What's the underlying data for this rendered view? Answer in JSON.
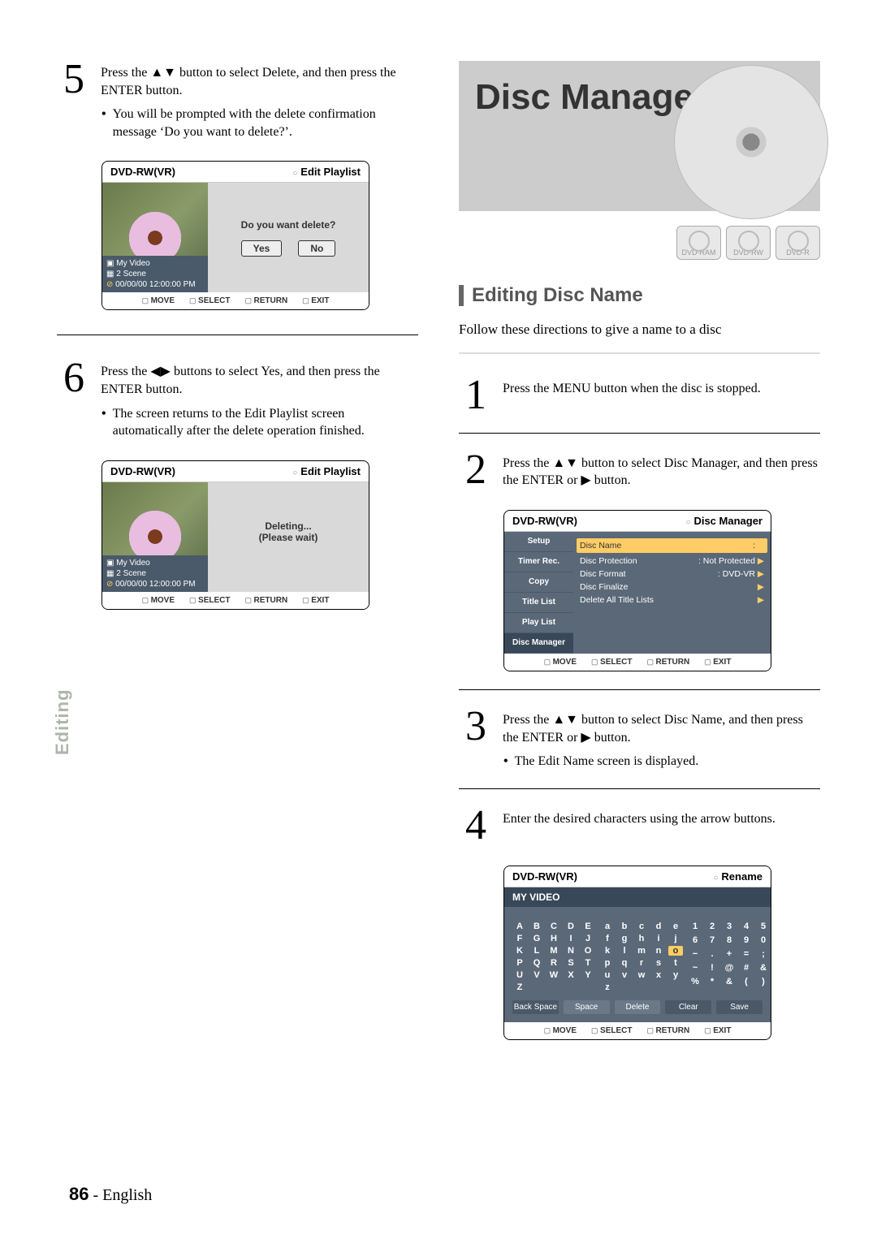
{
  "side_tab": "Editing",
  "footer_page": "86",
  "footer_lang": "English",
  "left": {
    "step5": {
      "num": "5",
      "text_a": "Press the ",
      "text_arrows": "▲▼",
      "text_b": " button to select Delete, and then press the ENTER button.",
      "bullet": "You will be prompted with the delete confirmation message ‘Do you want to delete?’."
    },
    "osd5": {
      "head_left": "DVD-RW(VR)",
      "head_right": "Edit Playlist",
      "thumb_title": "My Video",
      "thumb_scene": "2 Scene",
      "thumb_time": "00/00/00 12:00:00  PM",
      "msg": "Do you want delete?",
      "yes": "Yes",
      "no": "No",
      "foot": {
        "move": "MOVE",
        "select": "SELECT",
        "return": "RETURN",
        "exit": "EXIT"
      }
    },
    "step6": {
      "num": "6",
      "text_a": "Press the ",
      "text_arrows": "◀▶",
      "text_b": " buttons to select Yes, and then press the ENTER button.",
      "bullet": "The screen returns to the Edit Playlist screen automatically after the delete operation finished."
    },
    "osd6": {
      "head_left": "DVD-RW(VR)",
      "head_right": "Edit Playlist",
      "msg1": "Deleting...",
      "msg2": "(Please wait)",
      "thumb_title": "My Video",
      "thumb_scene": "2 Scene",
      "thumb_time": "00/00/00 12:00:00  PM",
      "foot": {
        "move": "MOVE",
        "select": "SELECT",
        "return": "RETURN",
        "exit": "EXIT"
      }
    }
  },
  "right": {
    "hero_title": "Disc Manager",
    "badges": [
      "DVD-RAM",
      "DVD-RW",
      "DVD-R"
    ],
    "section_title": "Editing Disc Name",
    "intro": "Follow these directions to give a name to a disc",
    "step1": {
      "num": "1",
      "text": "Press the MENU button when the disc is stopped."
    },
    "step2": {
      "num": "2",
      "text_a": "Press the ",
      "text_arrows": "▲▼",
      "text_b": " button to select Disc Manager, and then press the ENTER or ",
      "text_arrow2": "▶",
      "text_c": " button."
    },
    "osd2": {
      "head_left": "DVD-RW(VR)",
      "head_right": "Disc Manager",
      "side": [
        "Setup",
        "Timer Rec.",
        "Copy",
        "Title List",
        "Play List",
        "Disc Manager"
      ],
      "rows": [
        {
          "l": "Disc Name",
          "r": ":"
        },
        {
          "l": "Disc Protection",
          "r": ": Not Protected"
        },
        {
          "l": "Disc Format",
          "r": ": DVD-VR"
        },
        {
          "l": "Disc Finalize",
          "r": ""
        },
        {
          "l": "Delete All Title Lists",
          "r": ""
        }
      ],
      "foot": {
        "move": "MOVE",
        "select": "SELECT",
        "return": "RETURN",
        "exit": "EXIT"
      }
    },
    "step3": {
      "num": "3",
      "text_a": "Press the ",
      "text_arrows": "▲▼",
      "text_b": " button to select Disc Name, and then press the ENTER or ",
      "text_arrow2": "▶",
      "text_c": " button.",
      "bullet": "The Edit Name screen is displayed."
    },
    "step4": {
      "num": "4",
      "text": "Enter the desired characters using the arrow buttons."
    },
    "osd4": {
      "head_left": "DVD-RW(VR)",
      "head_right": "Rename",
      "title_field": "MY VIDEO",
      "grid_upper": [
        "A",
        "B",
        "C",
        "D",
        "E",
        "F",
        "G",
        "H",
        "I",
        "J",
        "K",
        "L",
        "M",
        "N",
        "O",
        "P",
        "Q",
        "R",
        "S",
        "T",
        "U",
        "V",
        "W",
        "X",
        "Y",
        "Z",
        "",
        "",
        "",
        ""
      ],
      "grid_lower": [
        "a",
        "b",
        "c",
        "d",
        "e",
        "f",
        "g",
        "h",
        "i",
        "j",
        "k",
        "l",
        "m",
        "n",
        "o",
        "p",
        "q",
        "r",
        "s",
        "t",
        "u",
        "v",
        "w",
        "x",
        "y",
        "z",
        "",
        "",
        "",
        ""
      ],
      "grid_sym": [
        "1",
        "2",
        "3",
        "4",
        "5",
        "6",
        "7",
        "8",
        "9",
        "0",
        "−",
        ".",
        "+",
        "=",
        ";",
        "~",
        "!",
        "@",
        "#",
        "&",
        "%",
        "*",
        "&",
        "(",
        ")",
        "",
        "",
        "",
        "",
        ""
      ],
      "btns": [
        "Back Space",
        "Space",
        "Delete",
        "Clear",
        "Save"
      ],
      "foot": {
        "move": "MOVE",
        "select": "SELECT",
        "return": "RETURN",
        "exit": "EXIT"
      },
      "hl_index": 14
    }
  }
}
